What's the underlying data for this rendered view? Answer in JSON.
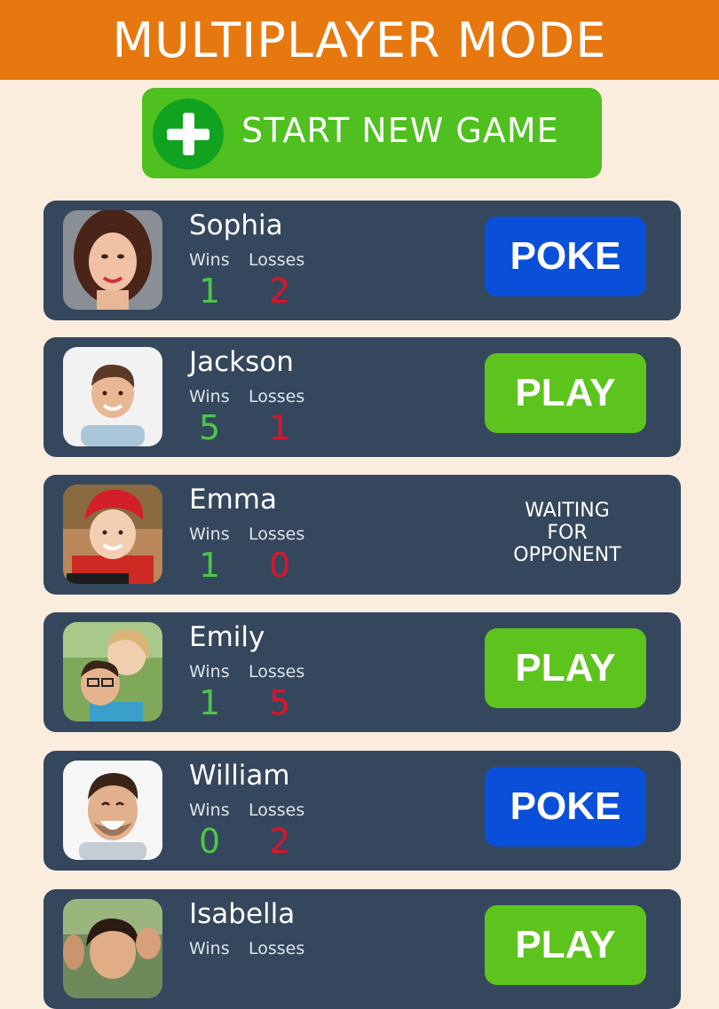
{
  "header": {
    "title": "MULTIPLAYER MODE"
  },
  "start_button": {
    "label": "START NEW GAME",
    "icon": "plus-icon"
  },
  "stats_labels": {
    "wins": "Wins",
    "losses": "Losses"
  },
  "colors": {
    "header_bg": "#e6780f",
    "page_bg": "#fbeddd",
    "card_bg": "#35475d",
    "start_green": "#4fc01f",
    "poke_blue": "#0a4fd9",
    "play_green": "#5cc41c",
    "wins_green": "#4cc64a",
    "losses_red": "#d9152a"
  },
  "players": [
    {
      "name": "Sophia",
      "wins": "1",
      "losses": "2",
      "action": "POKE"
    },
    {
      "name": "Jackson",
      "wins": "5",
      "losses": "1",
      "action": "PLAY"
    },
    {
      "name": "Emma",
      "wins": "1",
      "losses": "0",
      "action": "WAITING\nFOR\nOPPONENT"
    },
    {
      "name": "Emily",
      "wins": "1",
      "losses": "5",
      "action": "PLAY"
    },
    {
      "name": "William",
      "wins": "0",
      "losses": "2",
      "action": "POKE"
    },
    {
      "name": "Isabella",
      "wins": "",
      "losses": "",
      "action": "PLAY"
    }
  ]
}
